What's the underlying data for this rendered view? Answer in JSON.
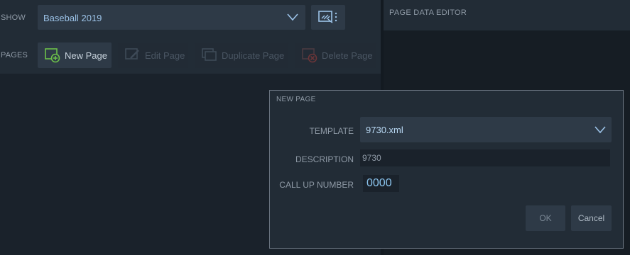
{
  "left": {
    "show_label": "SHOW",
    "show_value": "Baseball 2019",
    "pages_label": "PAGES",
    "toolbar": {
      "new_page": "New Page",
      "edit_page": "Edit Page",
      "duplicate_page": "Duplicate Page",
      "delete_page": "Delete Page"
    }
  },
  "right": {
    "title": "PAGE DATA EDITOR"
  },
  "dialog": {
    "title": "NEW PAGE",
    "template_label": "TEMPLATE",
    "template_value": "9730.xml",
    "description_label": "DESCRIPTION",
    "description_value": "9730",
    "call_up_label": "CALL UP NUMBER",
    "call_up_value": "0000",
    "ok_label": "OK",
    "cancel_label": "Cancel"
  },
  "colors": {
    "accent": "#9cc3e8",
    "new_icon_green": "#6cc04a",
    "delete_icon_red": "#8a3a3a"
  }
}
